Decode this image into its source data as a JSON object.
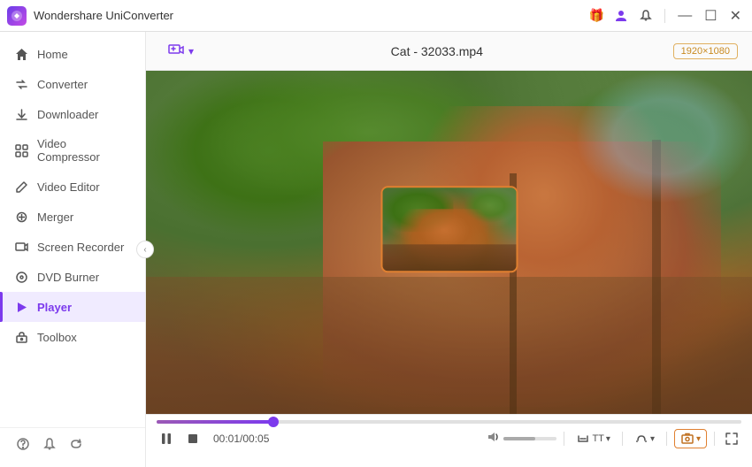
{
  "titleBar": {
    "appName": "Wondershare UniConverter",
    "icons": {
      "gift": "🎁",
      "user": "👤",
      "bell": "🔔"
    }
  },
  "sidebar": {
    "items": [
      {
        "id": "home",
        "label": "Home",
        "icon": "⌂"
      },
      {
        "id": "converter",
        "label": "Converter",
        "icon": "⇄"
      },
      {
        "id": "downloader",
        "label": "Downloader",
        "icon": "↓"
      },
      {
        "id": "video-compressor",
        "label": "Video Compressor",
        "icon": "⊞"
      },
      {
        "id": "video-editor",
        "label": "Video Editor",
        "icon": "✂"
      },
      {
        "id": "merger",
        "label": "Merger",
        "icon": "⊕"
      },
      {
        "id": "screen-recorder",
        "label": "Screen Recorder",
        "icon": "▣"
      },
      {
        "id": "dvd-burner",
        "label": "DVD Burner",
        "icon": "⊙"
      },
      {
        "id": "player",
        "label": "Player",
        "icon": "▶",
        "active": true
      },
      {
        "id": "toolbox",
        "label": "Toolbox",
        "icon": "⚙"
      }
    ],
    "bottomIcons": [
      "?",
      "🔔",
      "↺"
    ]
  },
  "player": {
    "addMediaLabel": "+",
    "addMediaDropdown": "▾",
    "fileTitle": "Cat - 32033.mp4",
    "resolution": "1920×1080",
    "progressPercent": 20,
    "progressThumbPercent": 20,
    "currentTime": "00:01/00:05",
    "volumePercent": 60,
    "controls": {
      "play": "⏸",
      "stop": "⏹",
      "time": "00:01/00:05",
      "volumeIcon": "🔊",
      "subtitleLabel": "TT",
      "audioLabel": "♫",
      "screenshotLabel": "⊞",
      "fullscreenLabel": "⛶"
    }
  }
}
